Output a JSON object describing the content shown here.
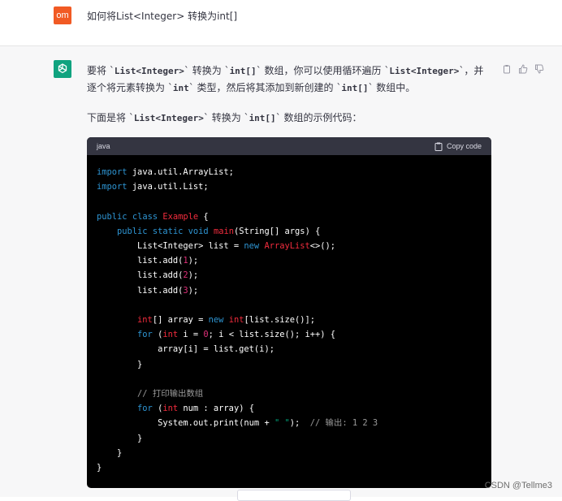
{
  "user": {
    "avatar_text": "om",
    "question": "如何将List<Integer> 转换为int[]"
  },
  "answer": {
    "p1": [
      "要将 `",
      "List<Integer>",
      "` 转换为 `",
      "int[]",
      "` 数组，你可以使用循环遍历 `",
      "List<Integer>",
      "`，并逐个将元素转换为 `",
      "int",
      "` 类型，然后将其添加到新创建的 `",
      "int[]",
      "` 数组中。"
    ],
    "p2": [
      "下面是将 `",
      "List<Integer>",
      "` 转换为 `",
      "int[]",
      "` 数组的示例代码："
    ]
  },
  "code": {
    "language": "java",
    "copy_label": "Copy code",
    "lines": [
      "import java.util.ArrayList;",
      "import java.util.List;",
      "",
      "public class Example {",
      "    public static void main(String[] args) {",
      "        List<Integer> list = new ArrayList<>();",
      "        list.add(1);",
      "        list.add(2);",
      "        list.add(3);",
      "",
      "        int[] array = new int[list.size()];",
      "        for (int i = 0; i < list.size(); i++) {",
      "            array[i] = list.get(i);",
      "        }",
      "",
      "        // 打印输出数组",
      "        for (int num : array) {",
      "            System.out.print(num + \" \");  // 输出: 1 2 3",
      "        }",
      "    }",
      "}"
    ]
  },
  "icons": {
    "copy": "clipboard-icon",
    "thumbs_up": "thumbs-up-icon",
    "thumbs_down": "thumbs-down-icon",
    "assistant_logo": "openai-logo-icon"
  },
  "colors": {
    "user_avatar": "#f15a24",
    "assistant_avatar": "#10a37f",
    "code_bg": "#000000",
    "code_header": "#343541"
  },
  "watermark": "CSDN @Tellme3"
}
